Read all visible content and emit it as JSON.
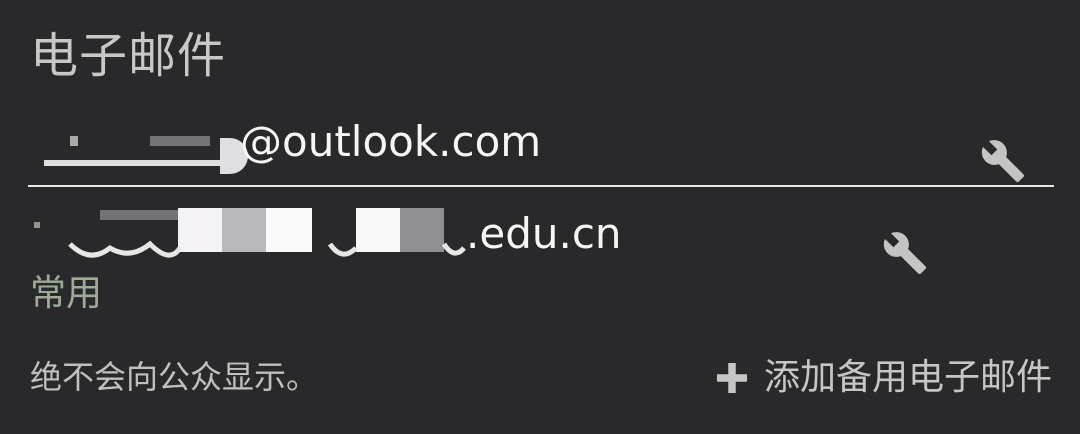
{
  "section": {
    "title": "电子邮件"
  },
  "emails": [
    {
      "visible_text": "@outlook.com",
      "action_icon": "wrench-icon"
    },
    {
      "visible_text": ".edu.cn",
      "action_icon": "wrench-icon",
      "usage": "常用"
    }
  ],
  "footer": {
    "visibility_note": "绝不会向公众显示。",
    "add_label": "添加备用电子邮件",
    "add_icon": "plus-icon"
  },
  "colors": {
    "background": "#29282b",
    "usage_label": "#9eab98",
    "divider": "#e6e6e6"
  }
}
